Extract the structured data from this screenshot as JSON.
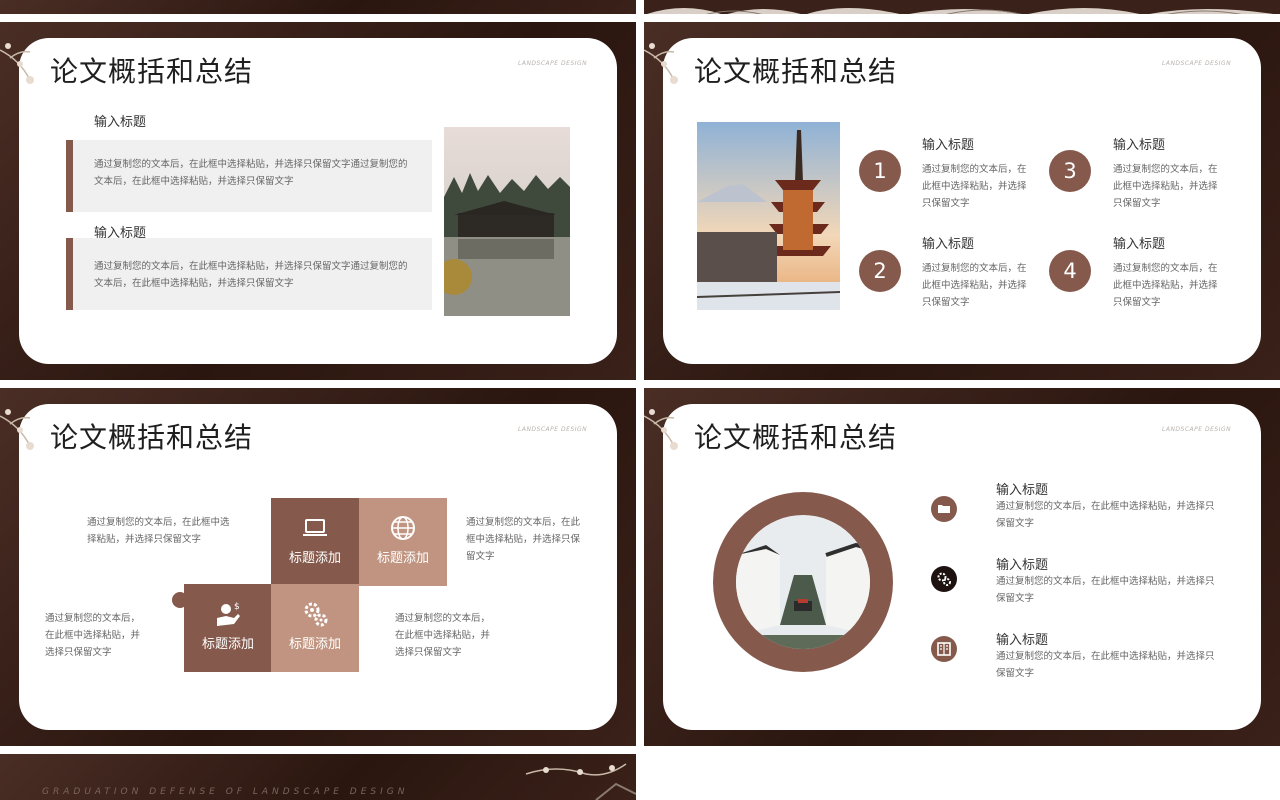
{
  "colors": {
    "accent": "#855a4c",
    "accent_light": "#c09480",
    "dark": "#2a160f",
    "box": "#f0f0f0"
  },
  "slides": {
    "s1": {
      "title": "论文概括和总结",
      "tag": "LANDSCAPE DESIGN",
      "items": [
        {
          "heading": "输入标题",
          "text": "通过复制您的文本后，在此框中选择粘贴，并选择只保留文字通过复制您的文本后，在此框中选择粘贴，并选择只保留文字"
        },
        {
          "heading": "输入标题",
          "text": "通过复制您的文本后，在此框中选择粘贴，并选择只保留文字通过复制您的文本后，在此框中选择粘贴，并选择只保留文字"
        }
      ]
    },
    "s2": {
      "title": "论文概括和总结",
      "tag": "LANDSCAPE DESIGN",
      "items": [
        {
          "num": "1",
          "heading": "输入标题",
          "text": "通过复制您的文本后，在此框中选择粘贴，并选择只保留文字"
        },
        {
          "num": "2",
          "heading": "输入标题",
          "text": "通过复制您的文本后，在此框中选择粘贴，并选择只保留文字"
        },
        {
          "num": "3",
          "heading": "输入标题",
          "text": "通过复制您的文本后，在此框中选择粘贴，并选择只保留文字"
        },
        {
          "num": "4",
          "heading": "输入标题",
          "text": "通过复制您的文本后，在此框中选择粘贴，并选择只保留文字"
        }
      ]
    },
    "s3": {
      "title": "论文概括和总结",
      "tag": "LANDSCAPE DESIGN",
      "tiles": [
        {
          "label": "标题添加",
          "icon": "laptop-icon"
        },
        {
          "label": "标题添加",
          "icon": "globe-icon"
        },
        {
          "label": "标题添加",
          "icon": "money-hand-icon"
        },
        {
          "label": "标题添加",
          "icon": "gears-icon"
        }
      ],
      "texts": [
        "通过复制您的文本后，在此框中选择粘贴，并选择只保留文字",
        "通过复制您的文本后，在此框中选择粘贴，并选择只保留文字",
        "通过复制您的文本后，在此框中选择粘贴，并选择只保留文字",
        "通过复制您的文本后，在此框中选择粘贴，并选择只保留文字"
      ]
    },
    "s4": {
      "title": "论文概括和总结",
      "tag": "LANDSCAPE DESIGN",
      "items": [
        {
          "heading": "输入标题",
          "text": "通过复制您的文本后，在此框中选择粘贴，并选择只保留文字",
          "icon": "folder-icon"
        },
        {
          "heading": "输入标题",
          "text": "通过复制您的文本后，在此框中选择粘贴，并选择只保留文字",
          "icon": "gears-icon"
        },
        {
          "heading": "输入标题",
          "text": "通过复制您的文本后，在此框中选择粘贴，并选择只保留文字",
          "icon": "book-icon"
        }
      ]
    },
    "s5": {
      "footer": "GRADUATION DEFENSE OF LANDSCAPE DESIGN"
    }
  }
}
